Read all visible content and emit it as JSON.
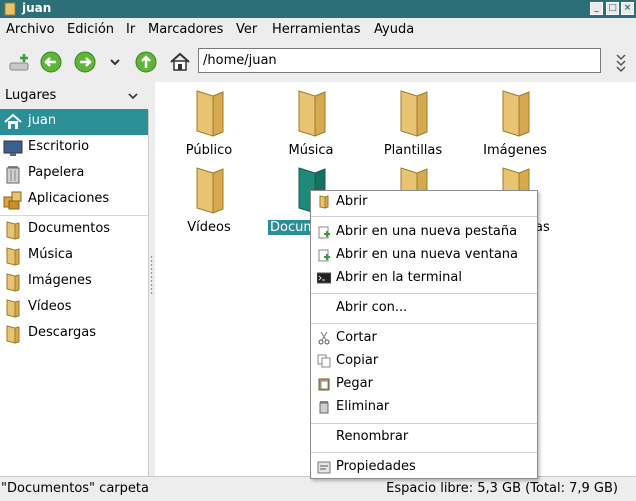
{
  "window": {
    "title": "juan"
  },
  "menubar": [
    "Archivo",
    "Edición",
    "Ir",
    "Marcadores",
    "Ver",
    "Herramientas",
    "Ayuda"
  ],
  "toolbar": {
    "location": "/home/juan"
  },
  "sidebar": {
    "header": "Lugares",
    "items": [
      {
        "label": "juan",
        "icon": "home-icon",
        "selected": true
      },
      {
        "label": "Escritorio",
        "icon": "desktop-icon"
      },
      {
        "label": "Papelera",
        "icon": "trash-icon"
      },
      {
        "label": "Aplicaciones",
        "icon": "applications-icon"
      },
      {
        "label": "Documentos",
        "icon": "folder-icon"
      },
      {
        "label": "Música",
        "icon": "folder-icon"
      },
      {
        "label": "Imágenes",
        "icon": "folder-icon"
      },
      {
        "label": "Vídeos",
        "icon": "folder-icon"
      },
      {
        "label": "Descargas",
        "icon": "folder-icon"
      }
    ]
  },
  "files": [
    {
      "label": "Público"
    },
    {
      "label": "Música"
    },
    {
      "label": "Plantillas"
    },
    {
      "label": "Imágenes"
    },
    {
      "label": "Vídeos"
    },
    {
      "label": "Docum",
      "selected": true
    },
    {
      "label": ""
    },
    {
      "label": "as"
    }
  ],
  "context_menu": [
    {
      "label": "Abrir",
      "icon": "open-folder-icon"
    },
    {
      "label": "Abrir en una nueva pestaña",
      "icon": "new-tab-icon"
    },
    {
      "label": "Abrir en una nueva ventana",
      "icon": "new-window-icon"
    },
    {
      "label": "Abrir en la terminal",
      "icon": "terminal-icon"
    },
    {
      "label": "Abrir con...",
      "icon": ""
    },
    {
      "label": "Cortar",
      "icon": "cut-icon"
    },
    {
      "label": "Copiar",
      "icon": "copy-icon"
    },
    {
      "label": "Pegar",
      "icon": "paste-icon"
    },
    {
      "label": "Eliminar",
      "icon": "delete-icon"
    },
    {
      "label": "Renombrar",
      "icon": ""
    },
    {
      "label": "Propiedades",
      "icon": "properties-icon"
    }
  ],
  "statusbar": {
    "left": "\"Documentos\" carpeta",
    "right": "Espacio libre: 5,3 GB (Total: 7,9 GB)"
  },
  "colors": {
    "titlebar": "#2d6f78",
    "selection": "#2c8e97",
    "folder": "#e8c472"
  }
}
